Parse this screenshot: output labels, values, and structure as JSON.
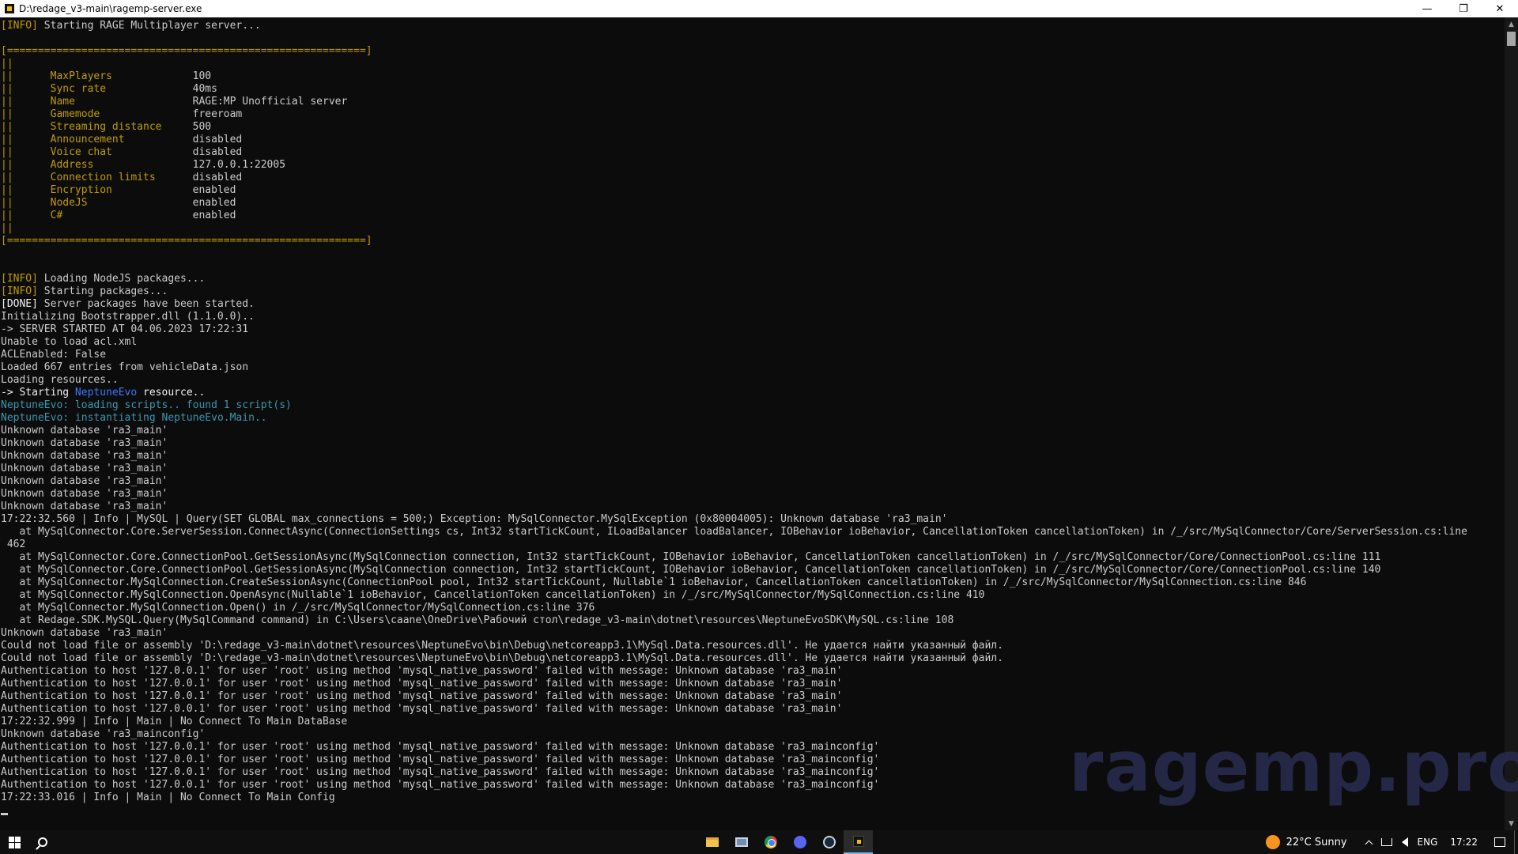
{
  "window": {
    "title": "D:\\redage_v3-main\\ragemp-server.exe",
    "minimize_glyph": "—",
    "maximize_glyph": "❐",
    "close_glyph": "✕"
  },
  "console": {
    "lines": [
      [
        [
          "y",
          "[INFO]"
        ],
        [
          "g",
          " Starting RAGE Multiplayer server..."
        ]
      ],
      [],
      [
        [
          "y",
          "[==========================================================]"
        ]
      ],
      [
        [
          "y",
          "||"
        ]
      ],
      [
        [
          "y",
          "||      MaxPlayers             "
        ],
        [
          "g",
          "100"
        ]
      ],
      [
        [
          "y",
          "||      Sync rate              "
        ],
        [
          "g",
          "40ms"
        ]
      ],
      [
        [
          "y",
          "||      Name                   "
        ],
        [
          "g",
          "RAGE:MP Unofficial server"
        ]
      ],
      [
        [
          "y",
          "||      Gamemode               "
        ],
        [
          "g",
          "freeroam"
        ]
      ],
      [
        [
          "y",
          "||      Streaming distance     "
        ],
        [
          "g",
          "500"
        ]
      ],
      [
        [
          "y",
          "||      Announcement           "
        ],
        [
          "g",
          "disabled"
        ]
      ],
      [
        [
          "y",
          "||      Voice chat             "
        ],
        [
          "g",
          "disabled"
        ]
      ],
      [
        [
          "y",
          "||      Address                "
        ],
        [
          "g",
          "127.0.0.1:22005"
        ]
      ],
      [
        [
          "y",
          "||      Connection limits      "
        ],
        [
          "g",
          "disabled"
        ]
      ],
      [
        [
          "y",
          "||      Encryption             "
        ],
        [
          "g",
          "enabled"
        ]
      ],
      [
        [
          "y",
          "||      NodeJS                 "
        ],
        [
          "g",
          "enabled"
        ]
      ],
      [
        [
          "y",
          "||      C#                     "
        ],
        [
          "g",
          "enabled"
        ]
      ],
      [
        [
          "y",
          "||"
        ]
      ],
      [
        [
          "y",
          "[==========================================================]"
        ]
      ],
      [],
      [],
      [
        [
          "y",
          "[INFO]"
        ],
        [
          "g",
          " Loading NodeJS packages..."
        ]
      ],
      [
        [
          "y",
          "[INFO]"
        ],
        [
          "g",
          " Starting packages..."
        ]
      ],
      [
        [
          "w",
          "[DONE]"
        ],
        [
          "g",
          " Server packages have been started."
        ]
      ],
      [
        [
          "g",
          "Initializing Bootstrapper.dll (1.1.0.0).."
        ]
      ],
      [
        [
          "g",
          "-> SERVER STARTED AT 04.06.2023 17:22:31"
        ]
      ],
      [
        [
          "g",
          "Unable to load acl.xml"
        ]
      ],
      [
        [
          "g",
          "ACLEnabled: False"
        ]
      ],
      [
        [
          "g",
          "Loaded 667 entries from vehicleData.json"
        ]
      ],
      [
        [
          "g",
          "Loading resources.."
        ]
      ],
      [
        [
          "w",
          "-> Starting "
        ],
        [
          "b",
          "NeptuneEvo"
        ],
        [
          "w",
          " resource.."
        ]
      ],
      [
        [
          "t",
          "NeptuneEvo: loading scripts.. found 1 script(s)"
        ]
      ],
      [
        [
          "t",
          "NeptuneEvo: instantiating "
        ],
        [
          "t",
          "NeptuneEvo.Main"
        ],
        [
          "t",
          ".."
        ]
      ],
      [
        [
          "g",
          "Unknown database 'ra3_main'"
        ]
      ],
      [
        [
          "g",
          "Unknown database 'ra3_main'"
        ]
      ],
      [
        [
          "g",
          "Unknown database 'ra3_main'"
        ]
      ],
      [
        [
          "g",
          "Unknown database 'ra3_main'"
        ]
      ],
      [
        [
          "g",
          "Unknown database 'ra3_main'"
        ]
      ],
      [
        [
          "g",
          "Unknown database 'ra3_main'"
        ]
      ],
      [
        [
          "g",
          "Unknown database 'ra3_main'"
        ]
      ],
      [
        [
          "g",
          "17:22:32.560 | Info | MySQL | Query(SET GLOBAL max_connections = 500;) Exception: MySqlConnector.MySqlException (0x80004005): Unknown database 'ra3_main'"
        ]
      ],
      [
        [
          "g",
          "   at MySqlConnector.Core.ServerSession.ConnectAsync(ConnectionSettings cs, Int32 startTickCount, ILoadBalancer loadBalancer, IOBehavior ioBehavior, CancellationToken cancellationToken) in /_/src/MySqlConnector/Core/ServerSession.cs:line"
        ]
      ],
      [
        [
          "g",
          " 462"
        ]
      ],
      [
        [
          "g",
          "   at MySqlConnector.Core.ConnectionPool.GetSessionAsync(MySqlConnection connection, Int32 startTickCount, IOBehavior ioBehavior, CancellationToken cancellationToken) in /_/src/MySqlConnector/Core/ConnectionPool.cs:line 111"
        ]
      ],
      [
        [
          "g",
          "   at MySqlConnector.Core.ConnectionPool.GetSessionAsync(MySqlConnection connection, Int32 startTickCount, IOBehavior ioBehavior, CancellationToken cancellationToken) in /_/src/MySqlConnector/Core/ConnectionPool.cs:line 140"
        ]
      ],
      [
        [
          "g",
          "   at MySqlConnector.MySqlConnection.CreateSessionAsync(ConnectionPool pool, Int32 startTickCount, Nullable`1 ioBehavior, CancellationToken cancellationToken) in /_/src/MySqlConnector/MySqlConnection.cs:line 846"
        ]
      ],
      [
        [
          "g",
          "   at MySqlConnector.MySqlConnection.OpenAsync(Nullable`1 ioBehavior, CancellationToken cancellationToken) in /_/src/MySqlConnector/MySqlConnection.cs:line 410"
        ]
      ],
      [
        [
          "g",
          "   at MySqlConnector.MySqlConnection.Open() in /_/src/MySqlConnector/MySqlConnection.cs:line 376"
        ]
      ],
      [
        [
          "g",
          "   at Redage.SDK.MySQL.Query(MySqlCommand command) in C:\\Users\\caane\\OneDrive\\Рабочий стол\\redage_v3-main\\dotnet\\resources\\NeptuneEvoSDK\\MySQL.cs:line 108"
        ]
      ],
      [
        [
          "g",
          "Unknown database 'ra3_main'"
        ]
      ],
      [
        [
          "g",
          "Could not load file or assembly 'D:\\redage_v3-main\\dotnet\\resources\\NeptuneEvo\\bin\\Debug\\netcoreapp3.1\\MySql.Data.resources.dll'. Не удается найти указанный файл."
        ]
      ],
      [
        [
          "g",
          "Could not load file or assembly 'D:\\redage_v3-main\\dotnet\\resources\\NeptuneEvo\\bin\\Debug\\netcoreapp3.1\\MySql.Data.resources.dll'. Не удается найти указанный файл."
        ]
      ],
      [
        [
          "g",
          "Authentication to host '127.0.0.1' for user 'root' using method 'mysql_native_password' failed with message: Unknown database 'ra3_main'"
        ]
      ],
      [
        [
          "g",
          "Authentication to host '127.0.0.1' for user 'root' using method 'mysql_native_password' failed with message: Unknown database 'ra3_main'"
        ]
      ],
      [
        [
          "g",
          "Authentication to host '127.0.0.1' for user 'root' using method 'mysql_native_password' failed with message: Unknown database 'ra3_main'"
        ]
      ],
      [
        [
          "g",
          "Authentication to host '127.0.0.1' for user 'root' using method 'mysql_native_password' failed with message: Unknown database 'ra3_main'"
        ]
      ],
      [
        [
          "g",
          "17:22:32.999 | Info | Main | No Connect To Main DataBase"
        ]
      ],
      [
        [
          "g",
          "Unknown database 'ra3_mainconfig'"
        ]
      ],
      [
        [
          "g",
          "Authentication to host '127.0.0.1' for user 'root' using method 'mysql_native_password' failed with message: Unknown database 'ra3_mainconfig'"
        ]
      ],
      [
        [
          "g",
          "Authentication to host '127.0.0.1' for user 'root' using method 'mysql_native_password' failed with message: Unknown database 'ra3_mainconfig'"
        ]
      ],
      [
        [
          "g",
          "Authentication to host '127.0.0.1' for user 'root' using method 'mysql_native_password' failed with message: Unknown database 'ra3_mainconfig'"
        ]
      ],
      [
        [
          "g",
          "Authentication to host '127.0.0.1' for user 'root' using method 'mysql_native_password' failed with message: Unknown database 'ra3_mainconfig'"
        ]
      ],
      [
        [
          "g",
          "17:22:33.016 | Info | Main | No Connect To Main Config"
        ]
      ]
    ]
  },
  "watermark": "ragemp.pro",
  "taskbar": {
    "apps": [
      {
        "name": "file-explorer",
        "icon": "folder-icon",
        "active": false
      },
      {
        "name": "remote-desktop",
        "icon": "monitor-icon",
        "active": false
      },
      {
        "name": "chrome",
        "icon": "chrome-icon",
        "active": false
      },
      {
        "name": "discord",
        "icon": "discord-icon",
        "active": false
      },
      {
        "name": "steam",
        "icon": "steam-icon",
        "active": false
      },
      {
        "name": "ragemp-server",
        "icon": "ragemp-icon",
        "active": true
      }
    ],
    "weather": "22°C  Sunny",
    "language": "ENG",
    "clock": "17:22"
  },
  "colors": {
    "console_bg": "#0c0c0c",
    "text_default": "#cccccc",
    "text_yellow": "#c19c00",
    "text_white": "#f2f2f2",
    "text_blue": "#3b78ff",
    "text_teal": "#3a96b0"
  }
}
